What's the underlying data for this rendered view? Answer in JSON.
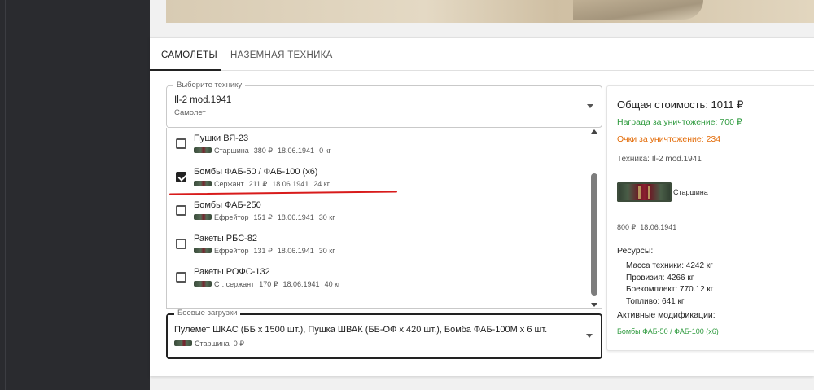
{
  "tabs": [
    {
      "label": "Самолеты",
      "active": true
    },
    {
      "label": "Наземная техника",
      "active": false
    }
  ],
  "tech_select": {
    "legend": "Выберите технику",
    "value": "Il-2 mod.1941",
    "subtitle": "Самолет"
  },
  "options": [
    {
      "title": "Пушки ВЯ-23",
      "rank": "Старшина",
      "price": "380 ₽",
      "date": "18.06.1941",
      "weight": "0 кг",
      "checked": false
    },
    {
      "title": "Бомбы ФАБ-50 / ФАБ-100 (x6)",
      "rank": "Сержант",
      "price": "211 ₽",
      "date": "18.06.1941",
      "weight": "24 кг",
      "checked": true
    },
    {
      "title": "Бомбы ФАБ-250",
      "rank": "Ефрейтор",
      "price": "151 ₽",
      "date": "18.06.1941",
      "weight": "30 кг",
      "checked": false
    },
    {
      "title": "Ракеты РБС-82",
      "rank": "Ефрейтор",
      "price": "131 ₽",
      "date": "18.06.1941",
      "weight": "30 кг",
      "checked": false
    },
    {
      "title": "Ракеты РОФС-132",
      "rank": "Ст. сержант",
      "price": "170 ₽",
      "date": "18.06.1941",
      "weight": "40 кг",
      "checked": false
    }
  ],
  "loadout": {
    "legend": "Боевые загрузки",
    "value": "Пулемет ШКАС (ББ x 1500 шт.), Пушка ШВАК (ББ-ОФ x 420 шт.), Бомба ФАБ-100М x 6 шт.",
    "rank": "Старшина",
    "price": "0 ₽"
  },
  "summary": {
    "total": "Общая стоимость: 1011 ₽",
    "reward": "Награда за уничтожение: 700 ₽",
    "points": "Очки за уничтожение: 234",
    "tech": "Техника: Il-2 mod.1941",
    "rank_name": "Старшина",
    "price": "800 ₽",
    "date": "18.06.1941",
    "resources_title": "Ресурсы:",
    "resources": [
      "Масса техники: 4242 кг",
      "Провизия: 4266 кг",
      "Боекомплект: 770.12 кг",
      "Топливо: 641 кг"
    ],
    "mods_title": "Активные модификации:",
    "mods": "Бомбы ФАБ-50 / ФАБ-100 (x6)"
  },
  "colors": {
    "reward": "#2e9a3e",
    "points": "#e36c09",
    "annotation": "#d81b1b"
  }
}
